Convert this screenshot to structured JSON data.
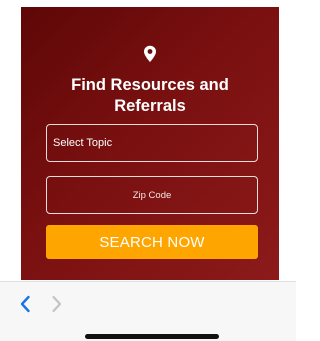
{
  "card": {
    "icon": "map-pin-icon",
    "title": "Find Resources and Referrals",
    "select_topic_label": "Select Topic",
    "zip_placeholder": "Zip Code",
    "search_button_label": "SEARCH NOW"
  },
  "browser": {
    "back_icon": "chevron-left-icon",
    "forward_icon": "chevron-right-icon"
  },
  "colors": {
    "card_dark": "#5e0707",
    "card_light": "#8c1a1a",
    "button": "#ffa500",
    "nav_active": "#1a73e8",
    "nav_disabled": "#c4c4c4"
  }
}
